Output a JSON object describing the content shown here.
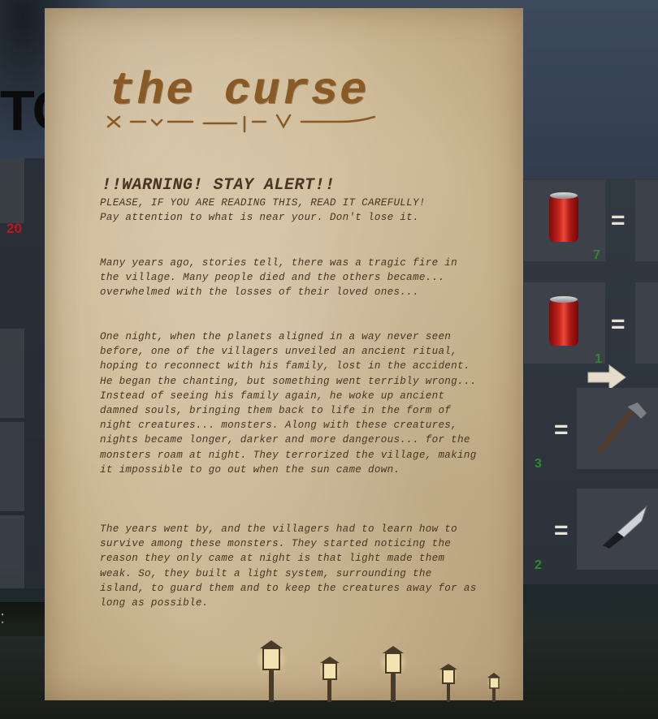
{
  "background": {
    "title_fragment": "TO",
    "left_counter": "20",
    "left_bar_glyph": ":"
  },
  "note": {
    "title": "the curse",
    "warning_title": "!!WARNING! STAY ALERT!!",
    "warning_line1": "PLEASE, IF YOU ARE READING THIS, READ IT CAREFULLY!",
    "warning_line2": "Pay attention to what is near your. Don't lose it.",
    "paragraphs": [
      "Many years ago, stories tell, there was a tragic fire in the village. Many people died and the others became... overwhelmed with the losses of their loved ones...",
      "One night, when the planets aligned in a way never seen before, one of the villagers unveiled an ancient ritual, hoping to reconnect with his family, lost in the accident.\nHe began the chanting, but something went terribly wrong... Instead of seeing his family again, he woke up ancient damned souls, bringing them back to life in the form of night creatures... monsters. Along with these creatures, nights became longer, darker and more dangerous... for the monsters roam at night. They terrorized the village, making it impossible to go out when the sun came down.",
      "The years went by, and the villagers had to learn how to survive among these monsters. They started noticing the reason they only came at night is that light made them weak. So, they built a light system, surrounding the island, to guard them and to keep the creatures away for as long as possible."
    ]
  },
  "recipes": {
    "rows": [
      {
        "icon": "soda-can-icon",
        "count": "7",
        "equals": "="
      },
      {
        "icon": "soda-can-icon",
        "count": "1",
        "equals": "="
      },
      {
        "icon": "axe-icon",
        "count": "3",
        "equals": "="
      },
      {
        "icon": "knife-icon",
        "count": "2",
        "equals": "="
      }
    ]
  },
  "colors": {
    "parchment": "#d9c9ad",
    "ink": "#4a3422",
    "title_ink": "#8a5a26",
    "count_green": "#2e8a2e",
    "counter_red": "#c0171c"
  }
}
